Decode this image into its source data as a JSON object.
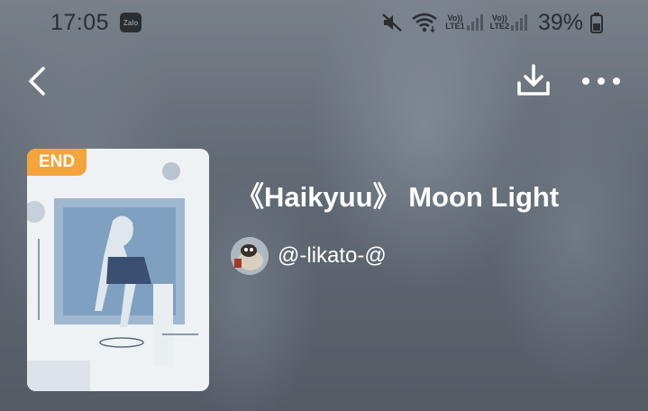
{
  "status_bar": {
    "time": "17:05",
    "notification_app": "Zalo",
    "icons": [
      "mute-icon",
      "wifi-icon",
      "signal-icon",
      "signal-icon",
      "battery-icon"
    ],
    "sim1_label_top": "Vo))",
    "sim1_label_bottom": "LTE1",
    "sim2_label_top": "Vo))",
    "sim2_label_bottom": "LTE2",
    "battery_percent": "39%"
  },
  "nav": {
    "back_icon": "chevron-left-icon",
    "download_icon": "download-icon",
    "more_icon": "more-horizontal-icon"
  },
  "story": {
    "status_badge": "END",
    "title": "《Haikyuu》 Moon Light",
    "author": "@-likato-@",
    "badge_color": "#f3a43a"
  }
}
